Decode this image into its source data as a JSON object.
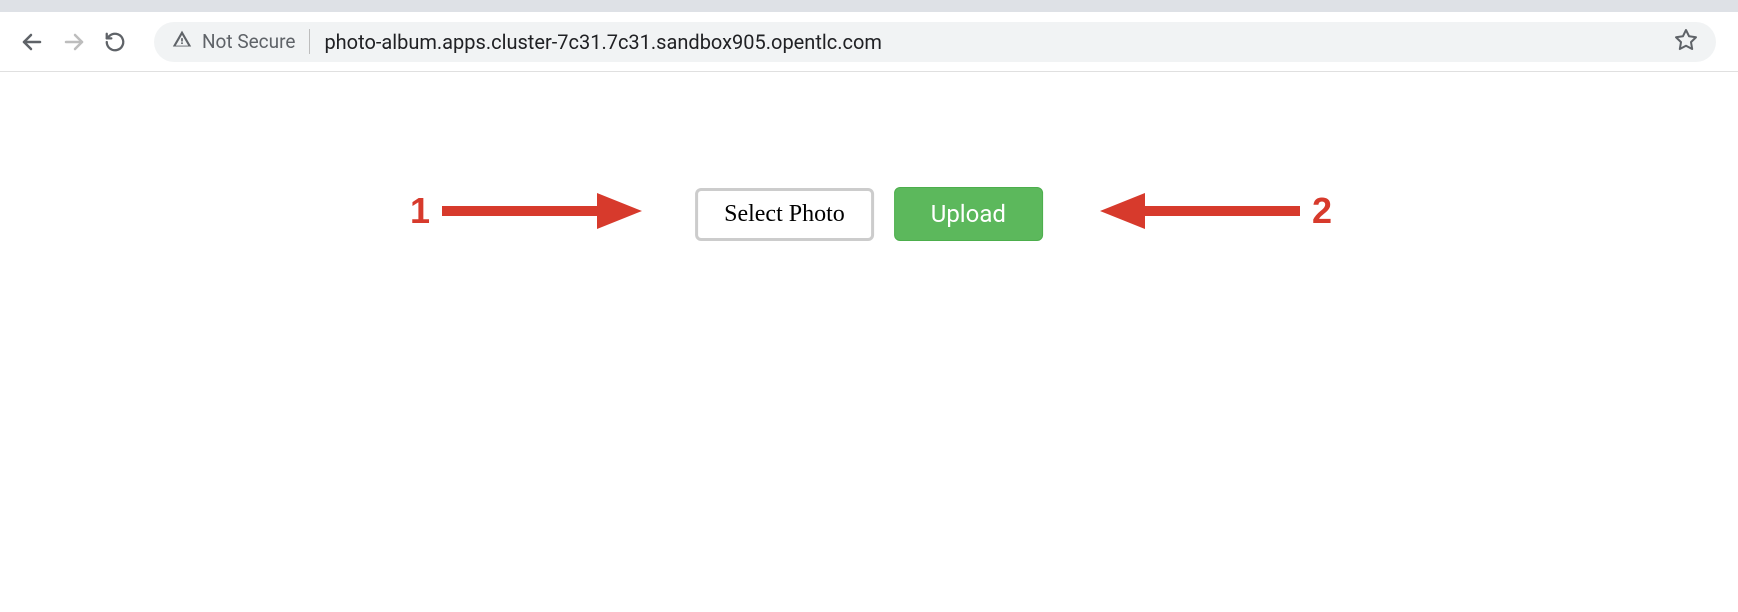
{
  "browser": {
    "security_label": "Not Secure",
    "url": "photo-album.apps.cluster-7c31.7c31.sandbox905.opentlc.com"
  },
  "page": {
    "select_photo_label": "Select Photo",
    "upload_label": "Upload"
  },
  "annotations": {
    "label_1": "1",
    "label_2": "2"
  }
}
